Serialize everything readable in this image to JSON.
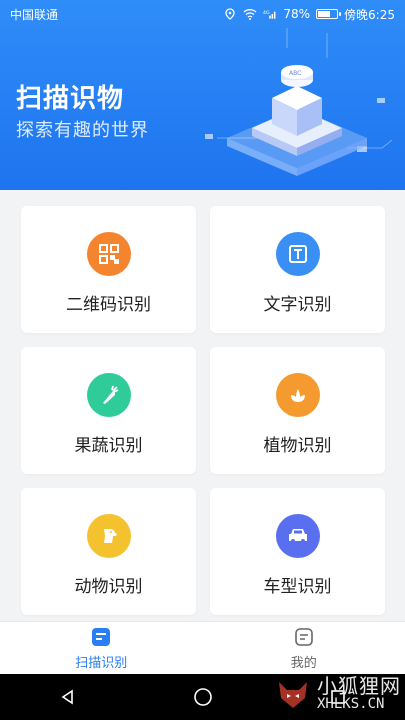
{
  "status_bar": {
    "carrier": "中国联通",
    "signal_label": "4G",
    "battery": "78%",
    "battery_level": 0.78,
    "time": "傍晚6:25"
  },
  "hero": {
    "title": "扫描识物",
    "subtitle": "探索有趣的世界"
  },
  "cards": [
    {
      "label": "二维码识别",
      "icon": "qr-code-icon",
      "color": "#f5842f"
    },
    {
      "label": "文字识别",
      "icon": "text-t-icon",
      "color": "#3a8ff5"
    },
    {
      "label": "果蔬识别",
      "icon": "carrot-icon",
      "color": "#2fcb98"
    },
    {
      "label": "植物识别",
      "icon": "flower-icon",
      "color": "#f59a2f"
    },
    {
      "label": "动物识别",
      "icon": "dog-icon",
      "color": "#f5c22f"
    },
    {
      "label": "车型识别",
      "icon": "car-icon",
      "color": "#5a6ff0"
    }
  ],
  "tabbar": {
    "tabs": [
      {
        "label": "扫描识别",
        "active": true
      },
      {
        "label": "我的",
        "active": false
      }
    ]
  },
  "watermark": {
    "cn": "小狐狸网",
    "en": "XHLKS.CN"
  },
  "colors": {
    "accent": "#2a7ef3",
    "hero_top": "#2f8df8",
    "hero_bottom": "#1e74ef"
  }
}
